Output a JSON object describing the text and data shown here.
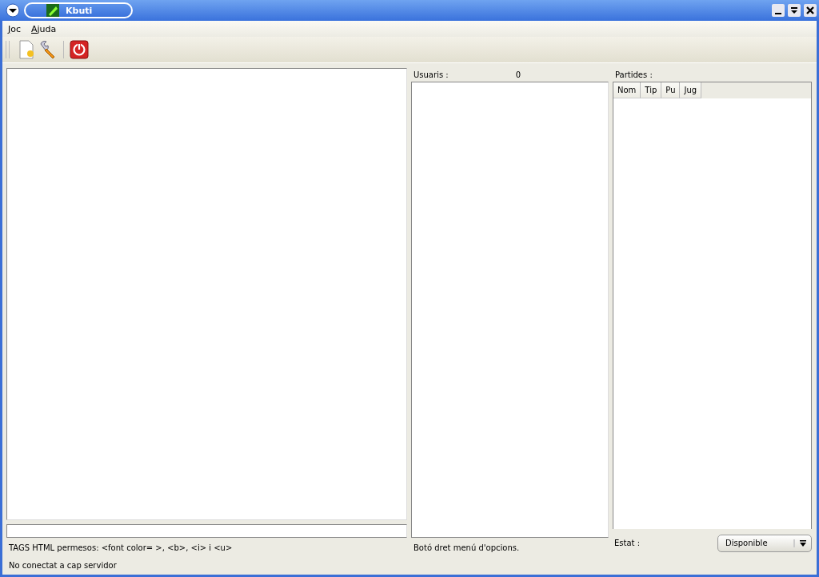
{
  "window": {
    "title": "Kbuti"
  },
  "menu": [
    {
      "label": "Joc"
    },
    {
      "label": "Ajuda"
    }
  ],
  "toolbar": [
    {
      "kind": "new"
    },
    {
      "kind": "settings"
    },
    {
      "kind": "power"
    }
  ],
  "chat": {
    "hint": "TAGS HTML permesos: <font color= >, <b>, <i> i <u>"
  },
  "users": {
    "label": "Usuaris :",
    "count": "0",
    "hint": "Botó dret menú d'opcions."
  },
  "games": {
    "label": "Partides :",
    "columns": [
      "Nom",
      "Tip",
      "Pu",
      "Jug"
    ]
  },
  "status": {
    "label": "Estat :",
    "value": "Disponible"
  },
  "status_bar": "No conectat a cap servidor"
}
